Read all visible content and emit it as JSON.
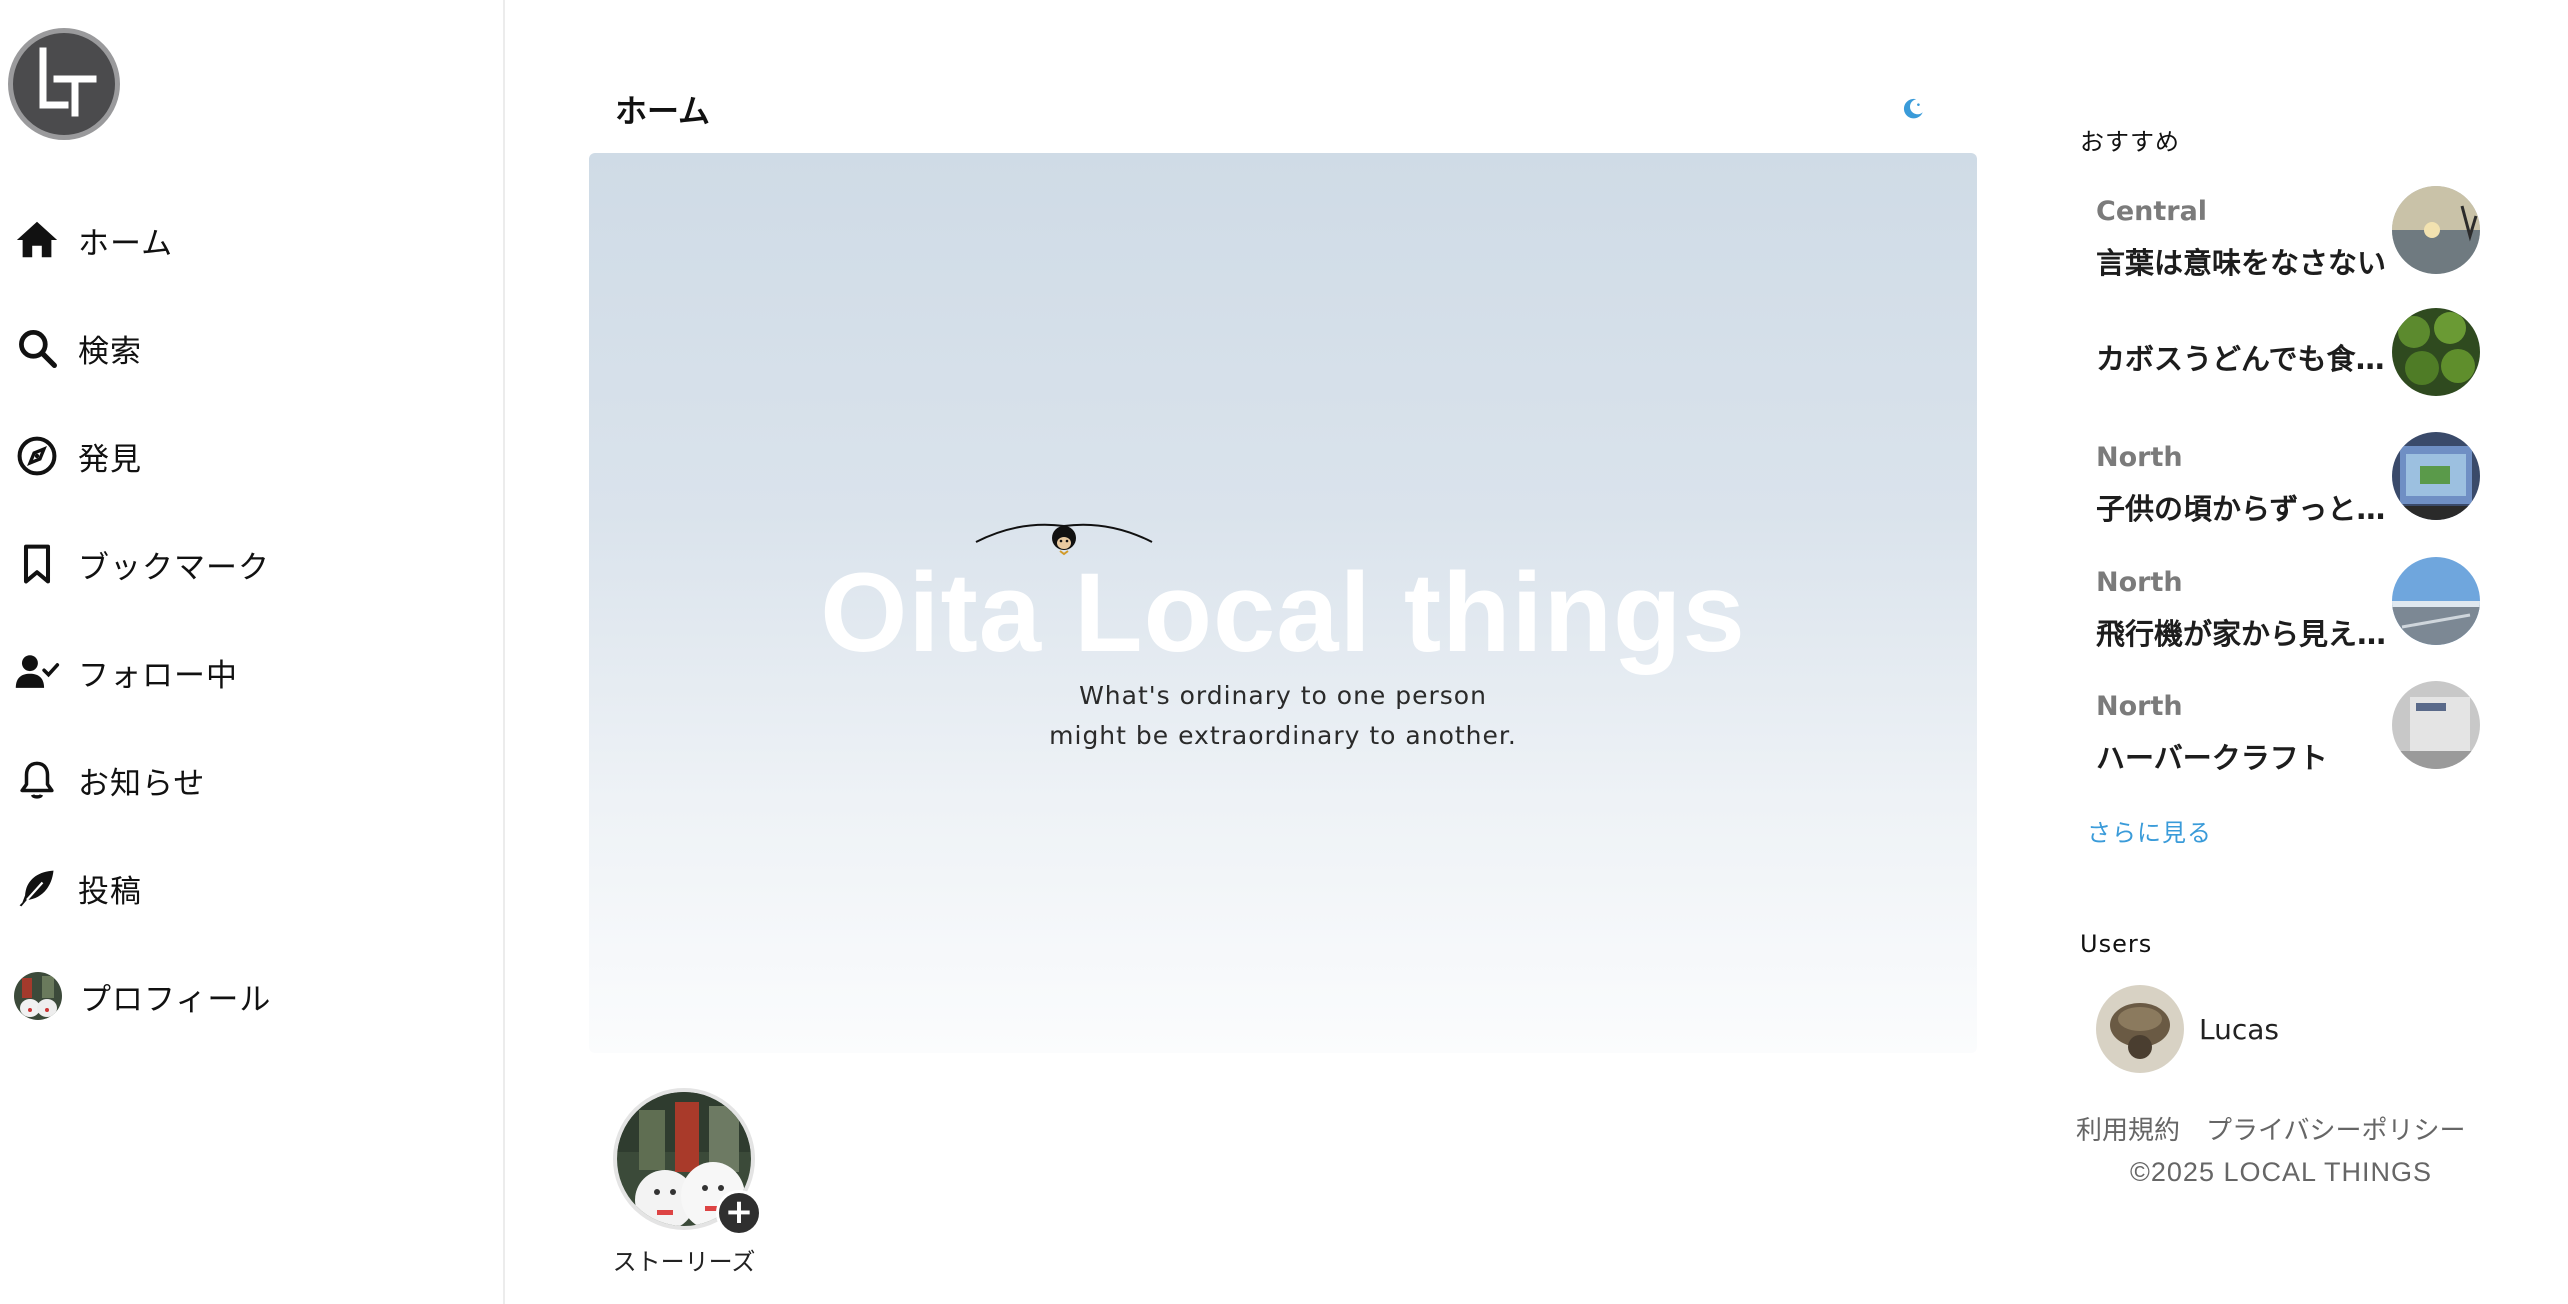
{
  "sidebar": {
    "logo_icon": "lt-logo-icon",
    "items": [
      {
        "label": "ホーム",
        "icon": "home-icon"
      },
      {
        "label": "検索",
        "icon": "search-icon"
      },
      {
        "label": "発見",
        "icon": "compass-icon"
      },
      {
        "label": "ブックマーク",
        "icon": "bookmark-icon"
      },
      {
        "label": "フォロー中",
        "icon": "user-check-icon"
      },
      {
        "label": "お知らせ",
        "icon": "bell-icon"
      },
      {
        "label": "投稿",
        "icon": "feather-icon"
      },
      {
        "label": "プロフィール",
        "icon": "avatar"
      }
    ]
  },
  "main": {
    "title": "ホーム",
    "theme_icon": "moon-icon",
    "hero": {
      "title": "Oita Local things",
      "subtitle_line1": "What's ordinary to one person",
      "subtitle_line2": "might be extraordinary to another."
    },
    "stories": {
      "label": "ストーリーズ",
      "add_symbol": "+"
    }
  },
  "right": {
    "recommend_title": "おすすめ",
    "recommendations": [
      {
        "region": "Central",
        "text": "言葉は意味をなさない",
        "thumb": "sunset-sea"
      },
      {
        "region": "",
        "text": "カボスうどんでも食べ…",
        "thumb": "kabosu"
      },
      {
        "region": "North",
        "text": "子供の頃からずっと…",
        "thumb": "map-screen"
      },
      {
        "region": "North",
        "text": "飛行機が家から見え…",
        "thumb": "airport"
      },
      {
        "region": "North",
        "text": "ハーバークラフト",
        "thumb": "building"
      }
    ],
    "see_more": "さらに見る",
    "users_title": "Users",
    "users": [
      {
        "name": "Lucas"
      }
    ],
    "footer": {
      "terms": "利用規約",
      "privacy": "プライバシーポリシー",
      "copyright": "©2025 LOCAL THINGS"
    }
  },
  "colors": {
    "accent": "#3a9bd9",
    "sidebar_border": "#ececec",
    "hero_top": "#cfdbe6",
    "hero_bottom": "#fbfcfd",
    "logo_bg": "#4b4b4d"
  }
}
